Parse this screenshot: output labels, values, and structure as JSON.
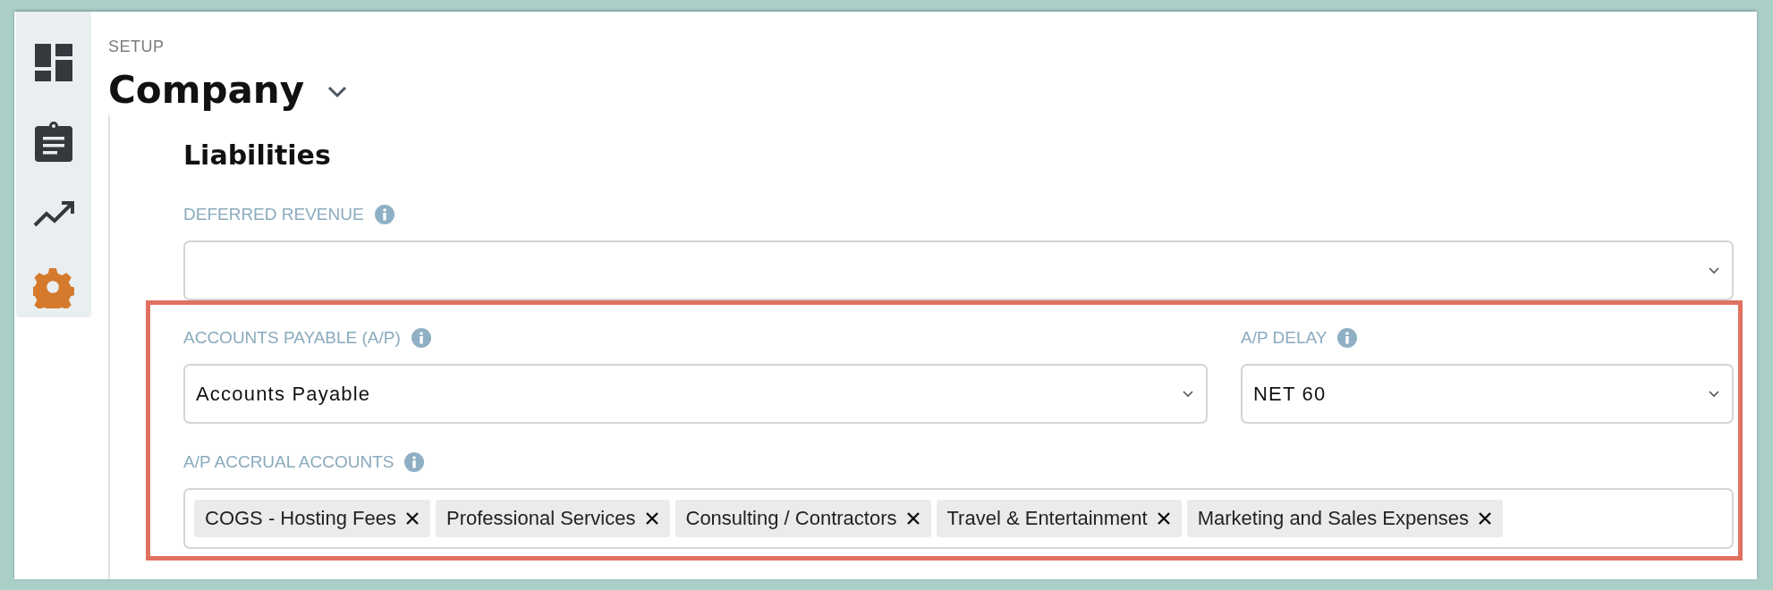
{
  "sidebar": {
    "items": [
      {
        "kind": "dashboard",
        "selected": false
      },
      {
        "kind": "clipboard",
        "selected": false
      },
      {
        "kind": "trend",
        "selected": false
      },
      {
        "kind": "settings",
        "selected": true
      }
    ]
  },
  "header": {
    "breadcrumb": "SETUP",
    "title": "Company"
  },
  "section": {
    "title": "Liabilities",
    "groups": [
      {
        "highlighted": false,
        "rows": [
          [
            {
              "label": "DEFERRED REVENUE",
              "kind": "select"
            }
          ]
        ]
      },
      {
        "highlighted": true,
        "rows": [
          [
            {
              "label": "ACCOUNTS PAYABLE (A/P)",
              "kind": "select",
              "value": "Accounts Payable"
            },
            {
              "label": "A/P DELAY",
              "kind": "select",
              "value": "NET 60"
            }
          ],
          [
            {
              "label": "A/P ACCRUAL ACCOUNTS",
              "kind": "multiselect",
              "tags": [
                "COGS - Hosting Fees",
                "Professional Services",
                "Consulting / Contractors",
                "Travel & Entertainment",
                "Marketing and Sales Expenses"
              ]
            }
          ]
        ]
      }
    ]
  }
}
